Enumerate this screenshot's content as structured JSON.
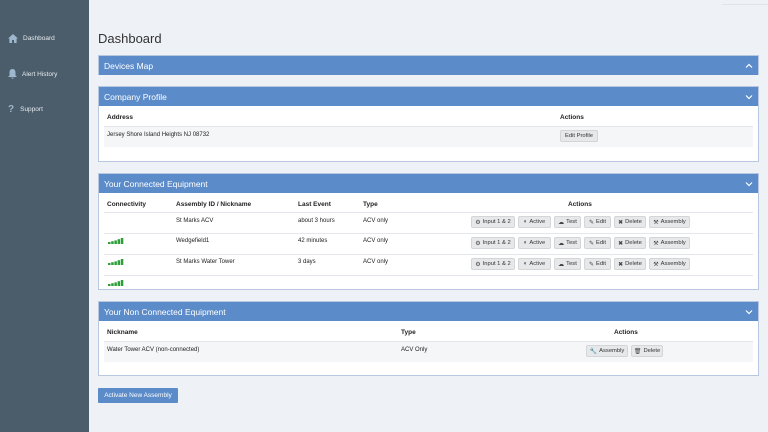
{
  "sidebar": {
    "items": [
      {
        "label": "Dashboard",
        "icon": "home-icon"
      },
      {
        "label": "Alert History",
        "icon": "bell-icon"
      },
      {
        "label": "Support",
        "icon": "question-icon"
      }
    ]
  },
  "page": {
    "title": "Dashboard"
  },
  "devices_map": {
    "title": "Devices Map"
  },
  "company_profile": {
    "title": "Company Profile",
    "col_address": "Address",
    "col_actions": "Actions",
    "address": "Jersey Shore Island Heights NJ 08732",
    "edit_label": "Edit Profile"
  },
  "connected": {
    "title": "Your Connected Equipment",
    "columns": [
      "Connectivity",
      "Assembly ID / Nickname",
      "Last Event",
      "Type",
      "Actions"
    ],
    "rows": [
      {
        "name": "St Marks ACV",
        "last_event": "about 3 hours",
        "type": "ACV only"
      },
      {
        "name": "Wedgefield1",
        "last_event": "42 minutes",
        "type": "ACV only"
      },
      {
        "name": "St Marks Water Tower",
        "last_event": "3 days",
        "type": "ACV only"
      }
    ],
    "actions": {
      "input": "Input 1 & 2",
      "active": "Active",
      "test": "Test",
      "edit": "Edit",
      "delete": "Delete",
      "assembly": "Assembly"
    },
    "signal_color": "#2e9e3a"
  },
  "non_connected": {
    "title": "Your Non Connected Equipment",
    "columns": [
      "Nickname",
      "Type",
      "Actions"
    ],
    "rows": [
      {
        "name": "Water Tower ACV (non-connected)",
        "type": "ACV Only"
      }
    ],
    "actions": {
      "assembly": "Assembly",
      "delete": "Delete"
    }
  },
  "activate_label": "Activate New Assembly",
  "colors": {
    "sidebar": "#4b5c6b",
    "accent": "#5b8bc9",
    "background": "#eef1f6"
  }
}
